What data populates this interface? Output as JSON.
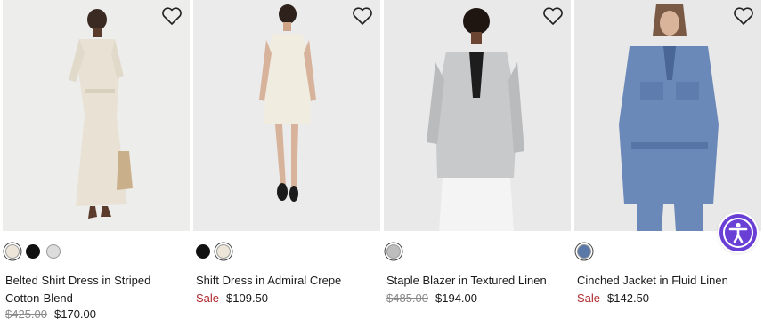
{
  "products": [
    {
      "name": "Belted Shirt Dress in Striped Cotton-Blend",
      "sale_label": "",
      "original_price": "$425.00",
      "price": "$170.00",
      "swatches": [
        {
          "color": "#ece5d8",
          "selected": true
        },
        {
          "color": "#111111",
          "selected": false
        },
        {
          "color": "#dcdcdc",
          "selected": false
        }
      ]
    },
    {
      "name": "Shift Dress in Admiral Crepe",
      "sale_label": "Sale",
      "original_price": "",
      "price": "$109.50",
      "swatches": [
        {
          "color": "#111111",
          "selected": false
        },
        {
          "color": "#ece5d8",
          "selected": true
        }
      ]
    },
    {
      "name": "Staple Blazer in Textured Linen",
      "sale_label": "",
      "original_price": "$485.00",
      "price": "$194.00",
      "swatches": [
        {
          "color": "#bdbdbd",
          "selected": true
        }
      ]
    },
    {
      "name": "Cinched Jacket in Fluid Linen",
      "sale_label": "Sale",
      "original_price": "",
      "price": "$142.50",
      "swatches": [
        {
          "color": "#5a78a8",
          "selected": true
        }
      ]
    }
  ],
  "colors": {
    "sale": "#b0282c",
    "strikethrough": "#8a8a8a",
    "accessibility_button": "#6a3fd6"
  },
  "icons": {
    "wishlist": "heart-icon",
    "accessibility": "accessibility-icon"
  }
}
